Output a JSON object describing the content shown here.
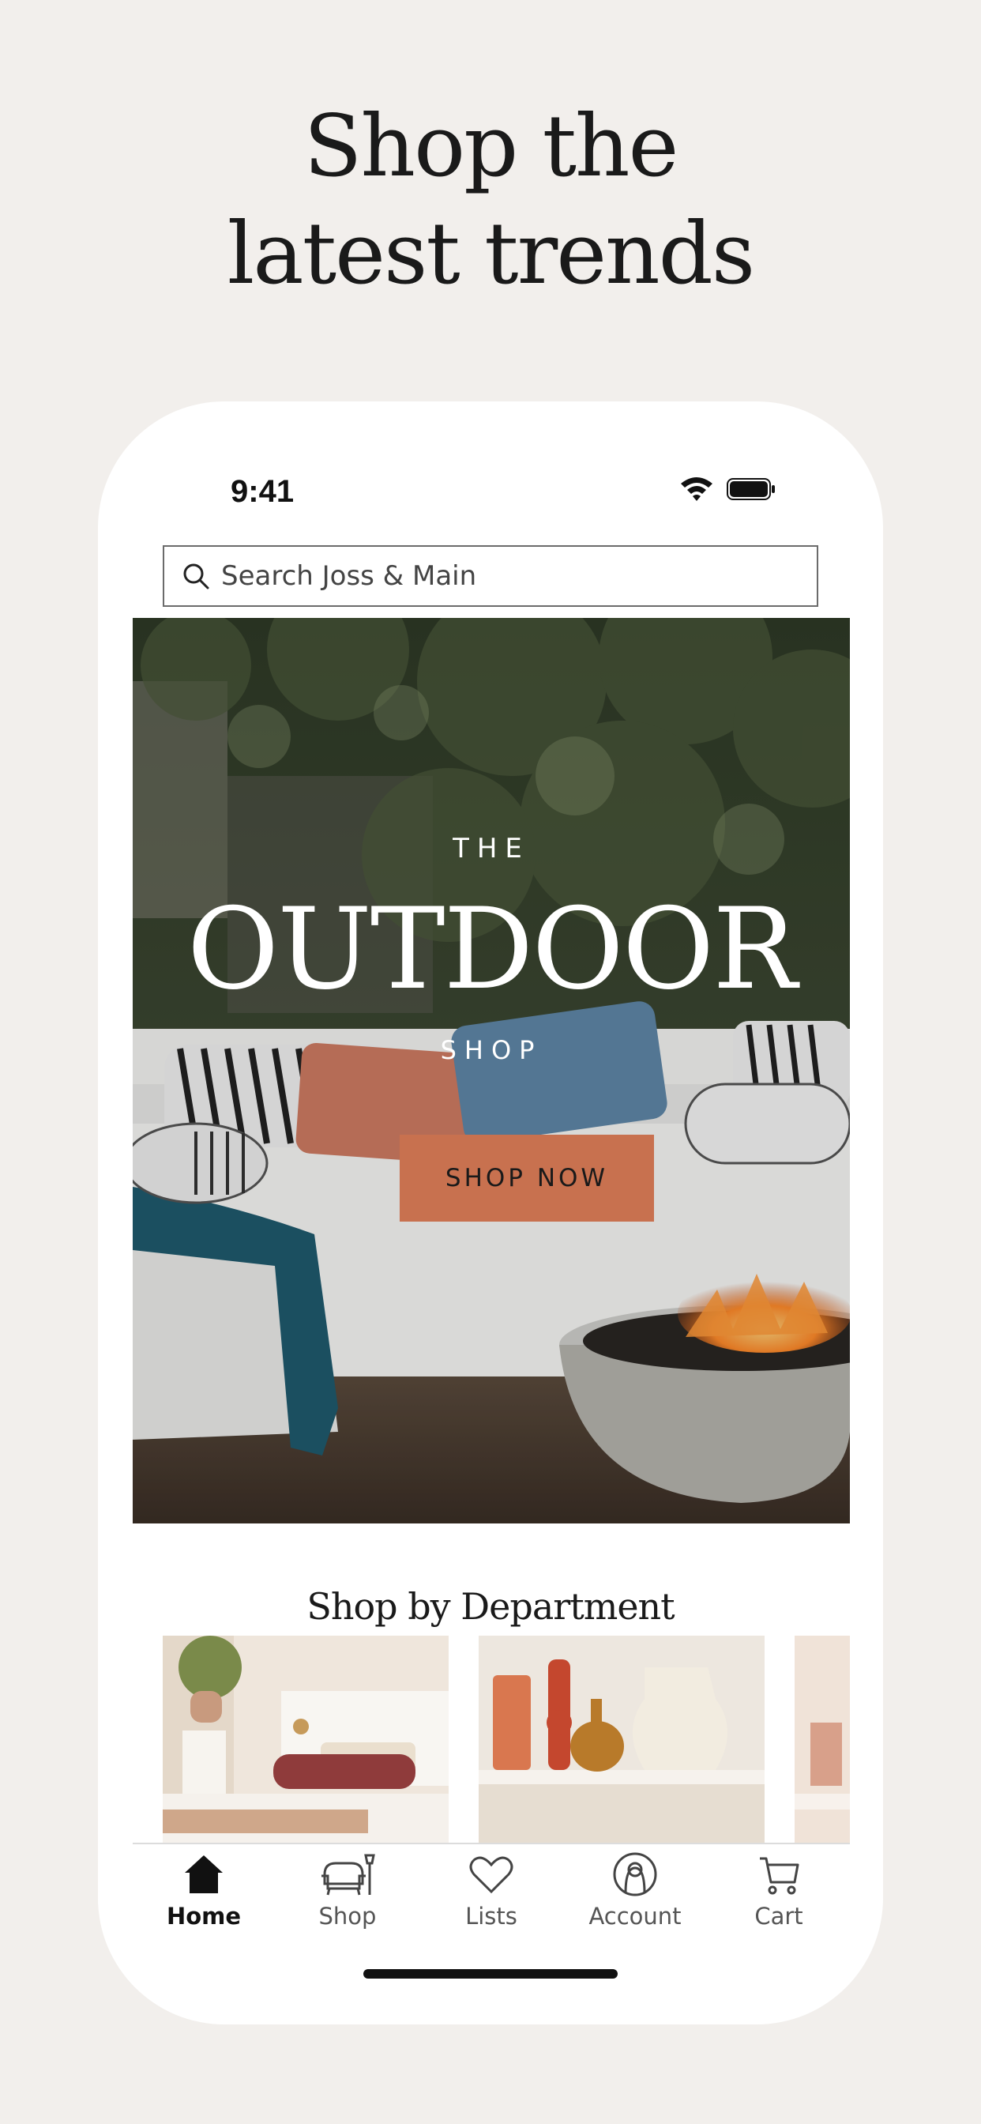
{
  "marketing": {
    "headline_line1": "Shop the",
    "headline_line2": "latest trends"
  },
  "status_bar": {
    "time": "9:41",
    "icons": [
      "wifi-icon",
      "battery-icon"
    ]
  },
  "search": {
    "placeholder": "Search Joss & Main",
    "icon": "search-icon"
  },
  "hero": {
    "eyebrow": "THE",
    "title": "OUTDOOR",
    "subtitle": "SHOP",
    "cta_label": "SHOP NOW",
    "cta_color": "#c8714f"
  },
  "departments": {
    "title": "Shop by Department"
  },
  "tabbar": {
    "items": [
      {
        "label": "Home",
        "icon": "home-icon",
        "active": true
      },
      {
        "label": "Shop",
        "icon": "furniture-icon",
        "active": false
      },
      {
        "label": "Lists",
        "icon": "heart-icon",
        "active": false
      },
      {
        "label": "Account",
        "icon": "account-icon",
        "active": false
      },
      {
        "label": "Cart",
        "icon": "cart-icon",
        "active": false
      }
    ]
  },
  "colors": {
    "background": "#f2efec",
    "accent": "#c8714f",
    "text": "#1a1a1a"
  }
}
